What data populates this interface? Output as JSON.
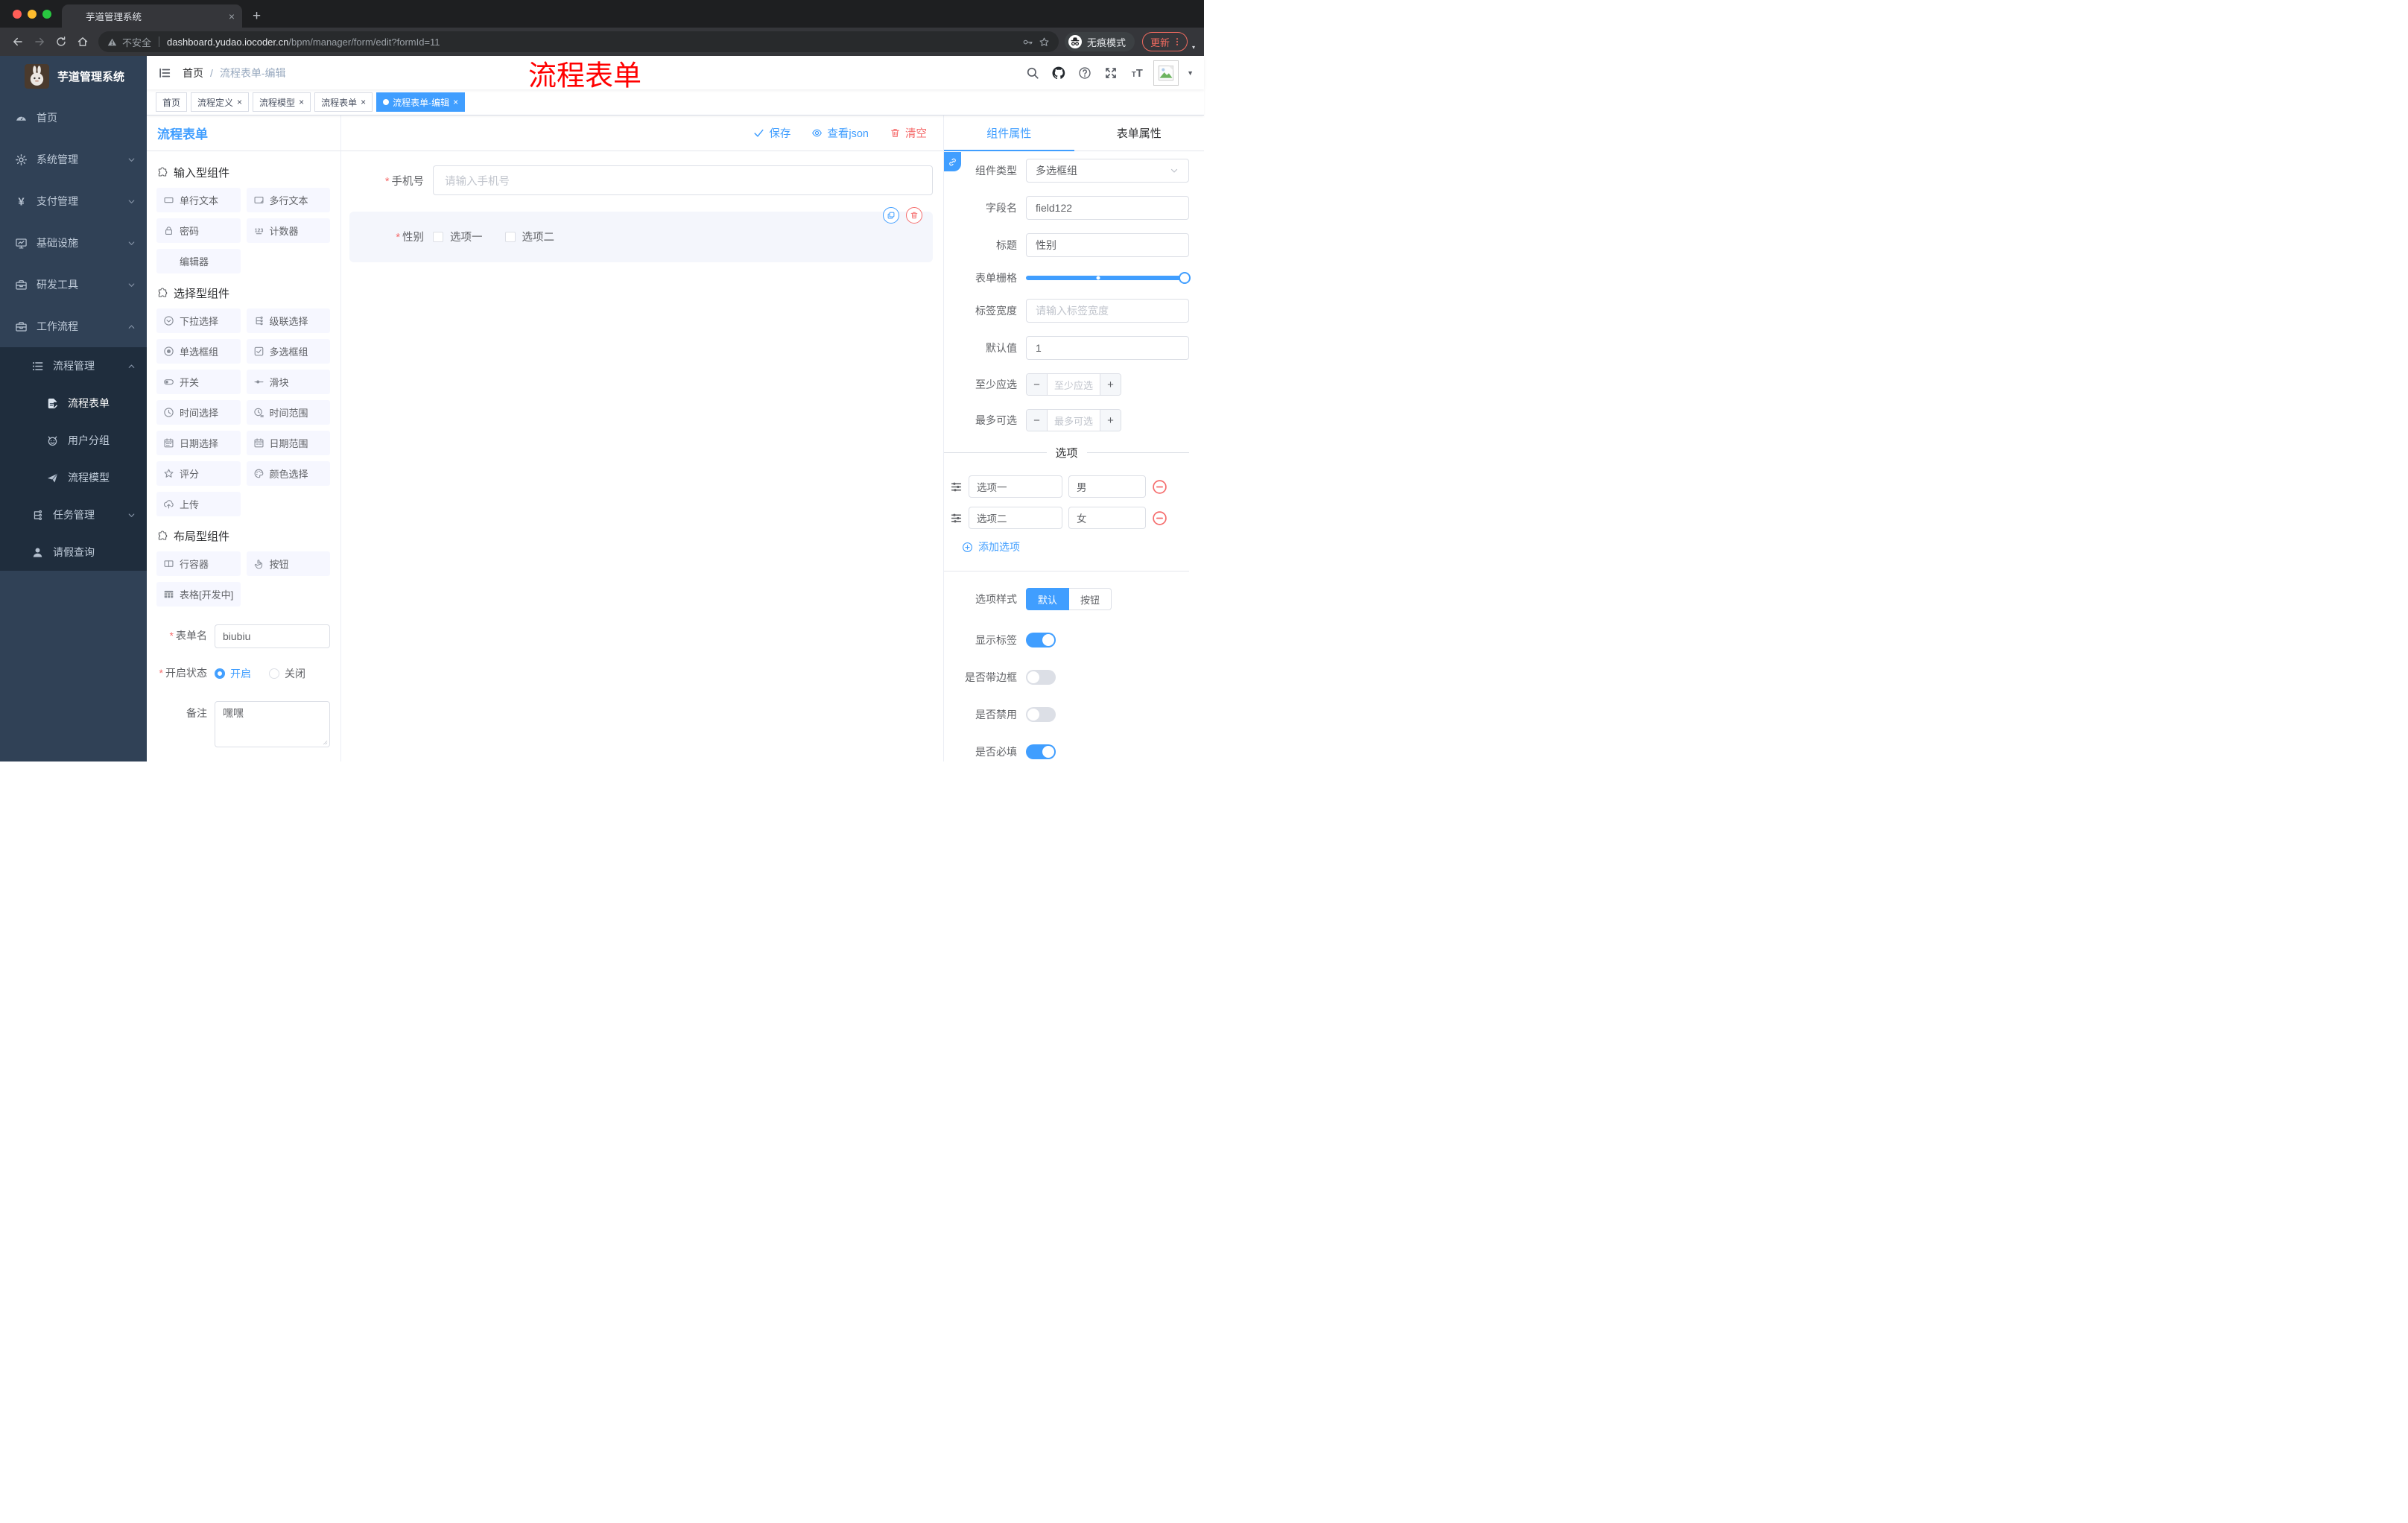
{
  "colors": {
    "accent": "#409eff",
    "danger": "#f56c6c",
    "annotation": "#ff0000",
    "sidebar_bg": "#304156",
    "submenu_bg": "#1f2d3d"
  },
  "browser": {
    "tab_title": "芋道管理系统",
    "not_secure": "不安全",
    "url_host": "dashboard.yudao.iocoder.cn",
    "url_path": "/bpm/manager/form/edit?formId=11",
    "incognito": "无痕模式",
    "update": "更新"
  },
  "app_header": {
    "breadcrumb_home": "首页",
    "breadcrumb_sep": "/",
    "breadcrumb_current": "流程表单-编辑",
    "annotation": "流程表单"
  },
  "sidebar": {
    "title": "芋道管理系统",
    "menu": [
      {
        "name": "home",
        "label": "首页",
        "icon": "dashboard-icon",
        "level": 1,
        "chevron": null
      },
      {
        "name": "system",
        "label": "系统管理",
        "icon": "gear-icon",
        "level": 1,
        "chevron": "down"
      },
      {
        "name": "payment",
        "label": "支付管理",
        "icon": "yen-icon",
        "level": 1,
        "chevron": "down"
      },
      {
        "name": "infrastructure",
        "label": "基础设施",
        "icon": "monitor-icon",
        "level": 1,
        "chevron": "down"
      },
      {
        "name": "devtools",
        "label": "研发工具",
        "icon": "toolbox-icon",
        "level": 1,
        "chevron": "down"
      },
      {
        "name": "workflow",
        "label": "工作流程",
        "icon": "toolbox-icon",
        "level": 1,
        "chevron": "up"
      },
      {
        "name": "process-mgmt",
        "label": "流程管理",
        "icon": "list-icon",
        "level": 2,
        "chevron": "up"
      },
      {
        "name": "process-form",
        "label": "流程表单",
        "icon": "doc-edit-icon",
        "level": 3,
        "chevron": null,
        "active": true
      },
      {
        "name": "user-group",
        "label": "用户分组",
        "icon": "robot-icon",
        "level": 3,
        "chevron": null
      },
      {
        "name": "process-model",
        "label": "流程模型",
        "icon": "plane-icon",
        "level": 3,
        "chevron": null
      },
      {
        "name": "task-mgmt",
        "label": "任务管理",
        "icon": "tree-icon",
        "level": 2,
        "chevron": "down"
      },
      {
        "name": "leave-query",
        "label": "请假查询",
        "icon": "user-icon",
        "level": 2,
        "chevron": null
      }
    ]
  },
  "tags": [
    {
      "name": "home",
      "label": "首页",
      "closable": false,
      "active": false
    },
    {
      "name": "process-definition",
      "label": "流程定义",
      "closable": true,
      "active": false
    },
    {
      "name": "process-model",
      "label": "流程模型",
      "closable": true,
      "active": false
    },
    {
      "name": "process-form",
      "label": "流程表单",
      "closable": true,
      "active": false
    },
    {
      "name": "process-form-edit",
      "label": "流程表单-编辑",
      "closable": true,
      "active": true
    }
  ],
  "palette": {
    "title": "流程表单",
    "sections": [
      {
        "title": "输入型组件",
        "items": [
          {
            "name": "single-line-text",
            "label": "单行文本",
            "icon": "rect-icon"
          },
          {
            "name": "multi-line-text",
            "label": "多行文本",
            "icon": "textarea-icon"
          },
          {
            "name": "password",
            "label": "密码",
            "icon": "lock-icon"
          },
          {
            "name": "counter",
            "label": "计数器",
            "icon": "counter-icon"
          },
          {
            "name": "editor",
            "label": "编辑器",
            "icon": null
          }
        ]
      },
      {
        "title": "选择型组件",
        "items": [
          {
            "name": "select",
            "label": "下拉选择",
            "icon": "select-icon"
          },
          {
            "name": "cascader",
            "label": "级联选择",
            "icon": "cascade-icon"
          },
          {
            "name": "radio-group",
            "label": "单选框组",
            "icon": "radio-icon"
          },
          {
            "name": "checkbox-group",
            "label": "多选框组",
            "icon": "checkbox-icon"
          },
          {
            "name": "switch",
            "label": "开关",
            "icon": "switch-icon"
          },
          {
            "name": "slider",
            "label": "滑块",
            "icon": "slider-icon"
          },
          {
            "name": "time-picker",
            "label": "时间选择",
            "icon": "clock-icon"
          },
          {
            "name": "time-range",
            "label": "时间范围",
            "icon": "time-range-icon"
          },
          {
            "name": "date-picker",
            "label": "日期选择",
            "icon": "calendar-icon"
          },
          {
            "name": "date-range",
            "label": "日期范围",
            "icon": "calendar-range-icon"
          },
          {
            "name": "rate",
            "label": "评分",
            "icon": "star-icon"
          },
          {
            "name": "color-picker",
            "label": "颜色选择",
            "icon": "palette-icon"
          },
          {
            "name": "upload",
            "label": "上传",
            "icon": "upload-icon"
          }
        ]
      },
      {
        "title": "布局型组件",
        "items": [
          {
            "name": "row-container",
            "label": "行容器",
            "icon": "row-icon"
          },
          {
            "name": "button",
            "label": "按钮",
            "icon": "hand-icon"
          },
          {
            "name": "table-dev",
            "label": "表格[开发中]",
            "icon": "table-icon"
          }
        ]
      }
    ],
    "form": {
      "name_label": "表单名",
      "name_value": "biubiu",
      "status_label": "开启状态",
      "status_on": "开启",
      "status_off": "关闭",
      "status_value": "开启",
      "remark_label": "备注",
      "remark_value": "嘿嘿"
    }
  },
  "canvas": {
    "save": "保存",
    "view_json": "查看json",
    "clear": "清空",
    "phone_label": "手机号",
    "phone_placeholder": "请输入手机号",
    "gender_label": "性别",
    "gender_options": [
      "选项一",
      "选项二"
    ]
  },
  "inspector": {
    "tab_component": "组件属性",
    "tab_form": "表单属性",
    "component_type_label": "组件类型",
    "component_type_value": "多选框组",
    "field_name_label": "字段名",
    "field_name_value": "field122",
    "title_label": "标题",
    "title_value": "性别",
    "grid_label": "表单栅格",
    "label_width_label": "标签宽度",
    "label_width_placeholder": "请输入标签宽度",
    "default_label": "默认值",
    "default_value": "1",
    "min_label": "至少应选",
    "min_placeholder": "至少应选",
    "max_label": "最多可选",
    "max_placeholder": "最多可选",
    "minus": "−",
    "plus": "+",
    "options_divider": "选项",
    "options": [
      {
        "label": "选项一",
        "value": "男"
      },
      {
        "label": "选项二",
        "value": "女"
      }
    ],
    "add_option": "添加选项",
    "style_label": "选项样式",
    "style_default": "默认",
    "style_button": "按钮",
    "style_value": "默认",
    "show_label_label": "显示标签",
    "border_label": "是否带边框",
    "disabled_label": "是否禁用",
    "required_label": "是否必填",
    "states": {
      "show_label": true,
      "border": false,
      "disabled": false,
      "required": true
    }
  }
}
